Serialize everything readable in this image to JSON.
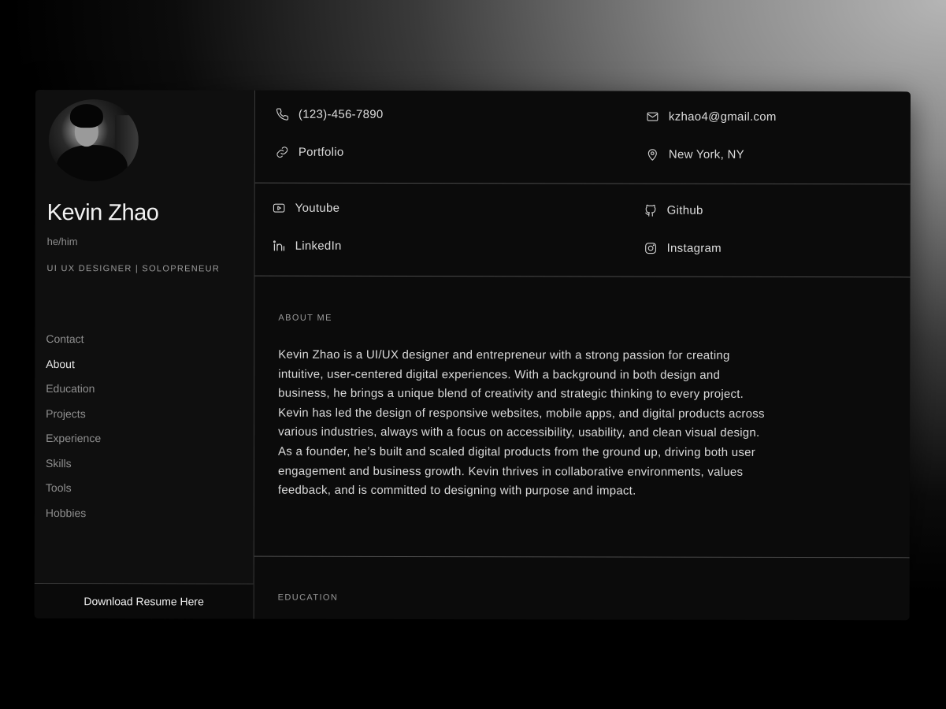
{
  "profile": {
    "name": "Kevin Zhao",
    "pronouns": "he/him",
    "title": "UI UX DESIGNER | SOLOPRENEUR"
  },
  "nav": {
    "items": [
      {
        "label": "Contact"
      },
      {
        "label": "About"
      },
      {
        "label": "Education"
      },
      {
        "label": "Projects"
      },
      {
        "label": "Experience"
      },
      {
        "label": "Skills"
      },
      {
        "label": "Tools"
      },
      {
        "label": "Hobbies"
      }
    ],
    "active": "About"
  },
  "download": {
    "label": "Download Resume Here"
  },
  "contact": {
    "phone": "(123)-456-7890",
    "email": "kzhao4@gmail.com",
    "portfolio": "Portfolio",
    "location": "New York, NY"
  },
  "social": {
    "youtube": "Youtube",
    "github": "Github",
    "linkedin": "LinkedIn",
    "instagram": "Instagram"
  },
  "about": {
    "heading": "ABOUT ME",
    "body": "Kevin Zhao is a UI/UX designer and entrepreneur with a strong passion for creating intuitive, user-centered digital experiences. With a background in both design and business, he brings a unique blend of creativity and strategic thinking to every project. Kevin has led the design of responsive websites, mobile apps, and digital products across various industries, always with a focus on accessibility, usability, and clean visual design. As a founder, he’s built and scaled digital products from the ground up, driving both user engagement and business growth. Kevin thrives in collaborative environments, values feedback, and is committed to designing with purpose and impact."
  },
  "education": {
    "heading": "EDUCATION"
  },
  "icons": [
    "phone-icon",
    "mail-icon",
    "link-icon",
    "location-pin-icon",
    "youtube-icon",
    "github-icon",
    "linkedin-icon",
    "instagram-icon"
  ]
}
